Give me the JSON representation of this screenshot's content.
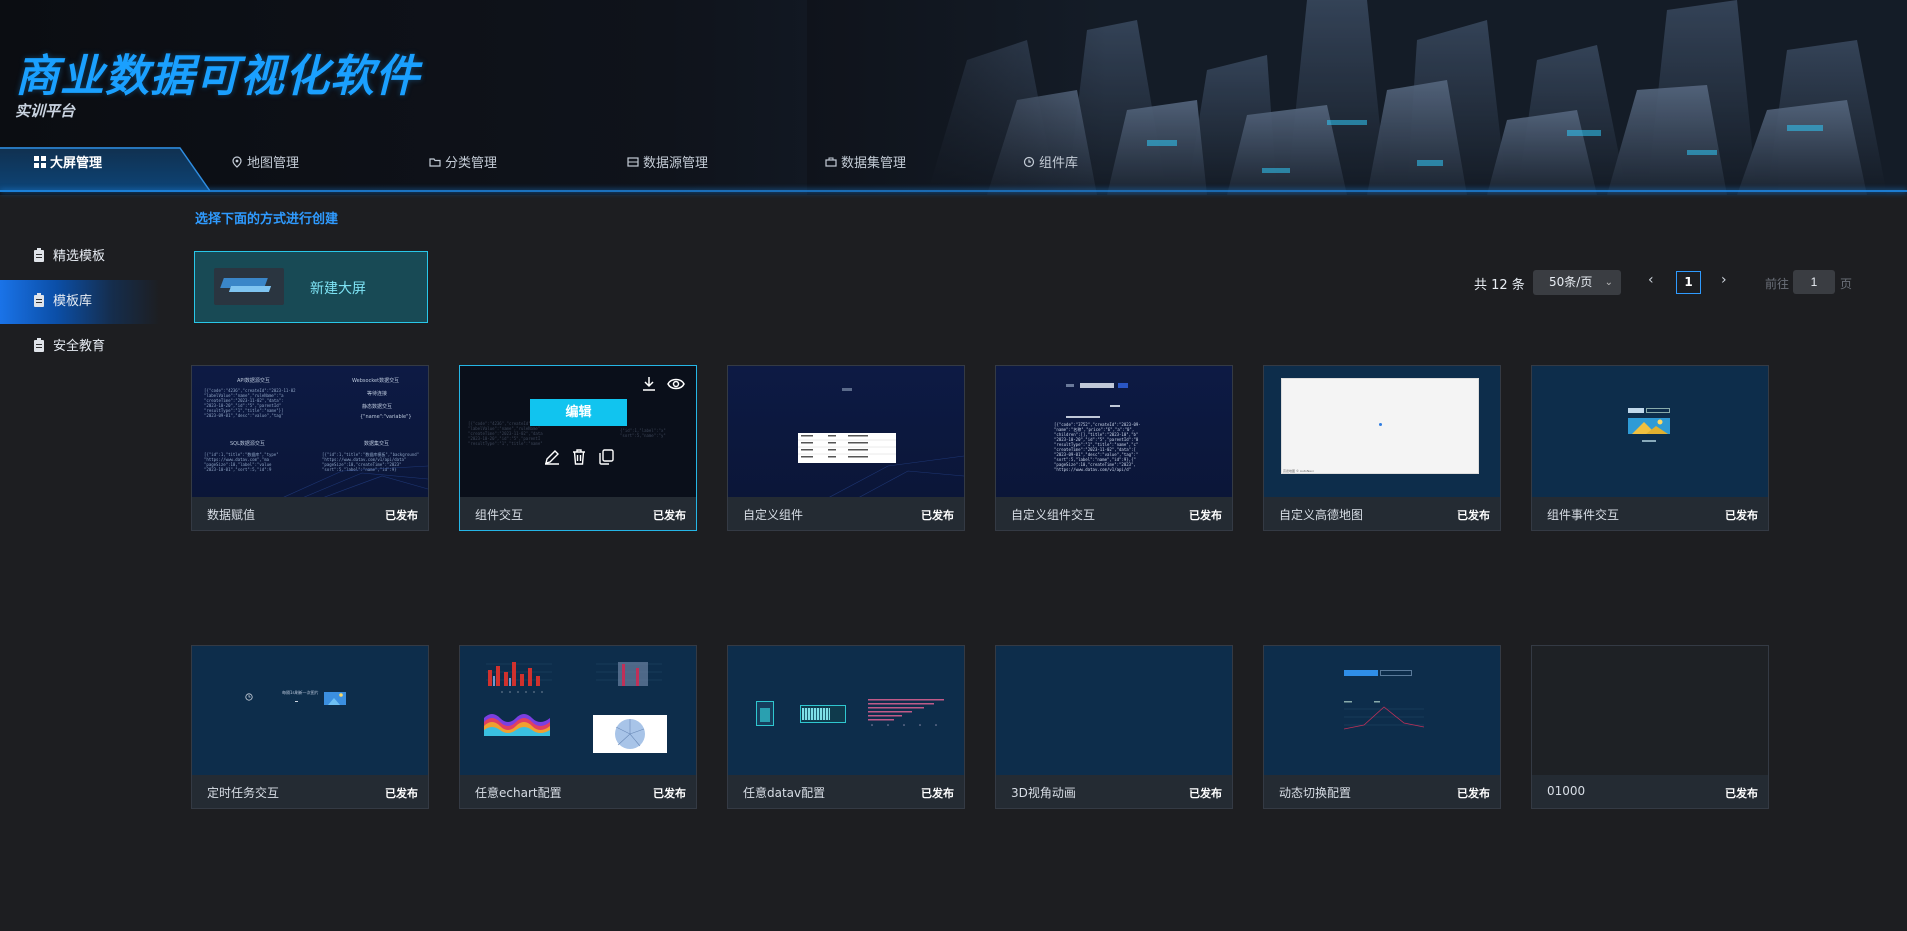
{
  "header": {
    "title": "商业数据可视化软件",
    "subtitle": "实训平台"
  },
  "nav": {
    "items": [
      {
        "label": "大屏管理",
        "icon": "grid-icon",
        "active": true
      },
      {
        "label": "地图管理",
        "icon": "location-pin-icon"
      },
      {
        "label": "分类管理",
        "icon": "folder-icon"
      },
      {
        "label": "数据源管理",
        "icon": "database-icon"
      },
      {
        "label": "数据集管理",
        "icon": "briefcase-icon"
      },
      {
        "label": "组件库",
        "icon": "component-icon"
      }
    ]
  },
  "sidebar": {
    "items": [
      {
        "label": "精选模板",
        "icon": "clipboard-icon"
      },
      {
        "label": "模板库",
        "icon": "clipboard-icon",
        "active": true
      },
      {
        "label": "安全教育",
        "icon": "clipboard-icon"
      }
    ]
  },
  "main": {
    "hint": "选择下面的方式进行创建",
    "new_screen_label": "新建大屏"
  },
  "pagination": {
    "total": "共 12 条",
    "page_size": "50条/页",
    "prev_icon": "‹",
    "next_icon": "›",
    "current_page": "1",
    "goto_prefix": "前往",
    "goto_value": "1",
    "goto_suffix": "页"
  },
  "cards": [
    {
      "name": "数据赋值",
      "status": "已发布"
    },
    {
      "name": "组件交互",
      "status": "已发布",
      "hover_action": "编辑"
    },
    {
      "name": "自定义组件",
      "status": "已发布"
    },
    {
      "name": "自定义组件交互",
      "status": "已发布"
    },
    {
      "name": "自定义高德地图",
      "status": "已发布"
    },
    {
      "name": "组件事件交互",
      "status": "已发布"
    },
    {
      "name": "定时任务交互",
      "status": "已发布"
    },
    {
      "name": "任意echart配置",
      "status": "已发布"
    },
    {
      "name": "任意datav配置",
      "status": "已发布"
    },
    {
      "name": "3D视角动画",
      "status": "已发布"
    },
    {
      "name": "动态切换配置",
      "status": "已发布"
    },
    {
      "name": "01000",
      "status": "已发布"
    }
  ],
  "thumbnail_text": {
    "card1": {
      "api_title": "API数据源交互",
      "ws_title": "Websocket数据交互",
      "ws_status": "等待连接",
      "static_title": "静态数据交互",
      "static_body": "{\"name\":\"variable\"}",
      "sql_title": "SQL数据源交互",
      "db_title": "数据集交互"
    },
    "card5": {
      "footer": "高德地图 © AutoNavi"
    },
    "card7": {
      "caption": "每隔1s刷新一次图片"
    }
  },
  "colors": {
    "accent": "#2f9bff",
    "brand_title": "#1aa0ff",
    "edit_button": "#11c4ef",
    "new_card_border": "#29c7e8"
  }
}
